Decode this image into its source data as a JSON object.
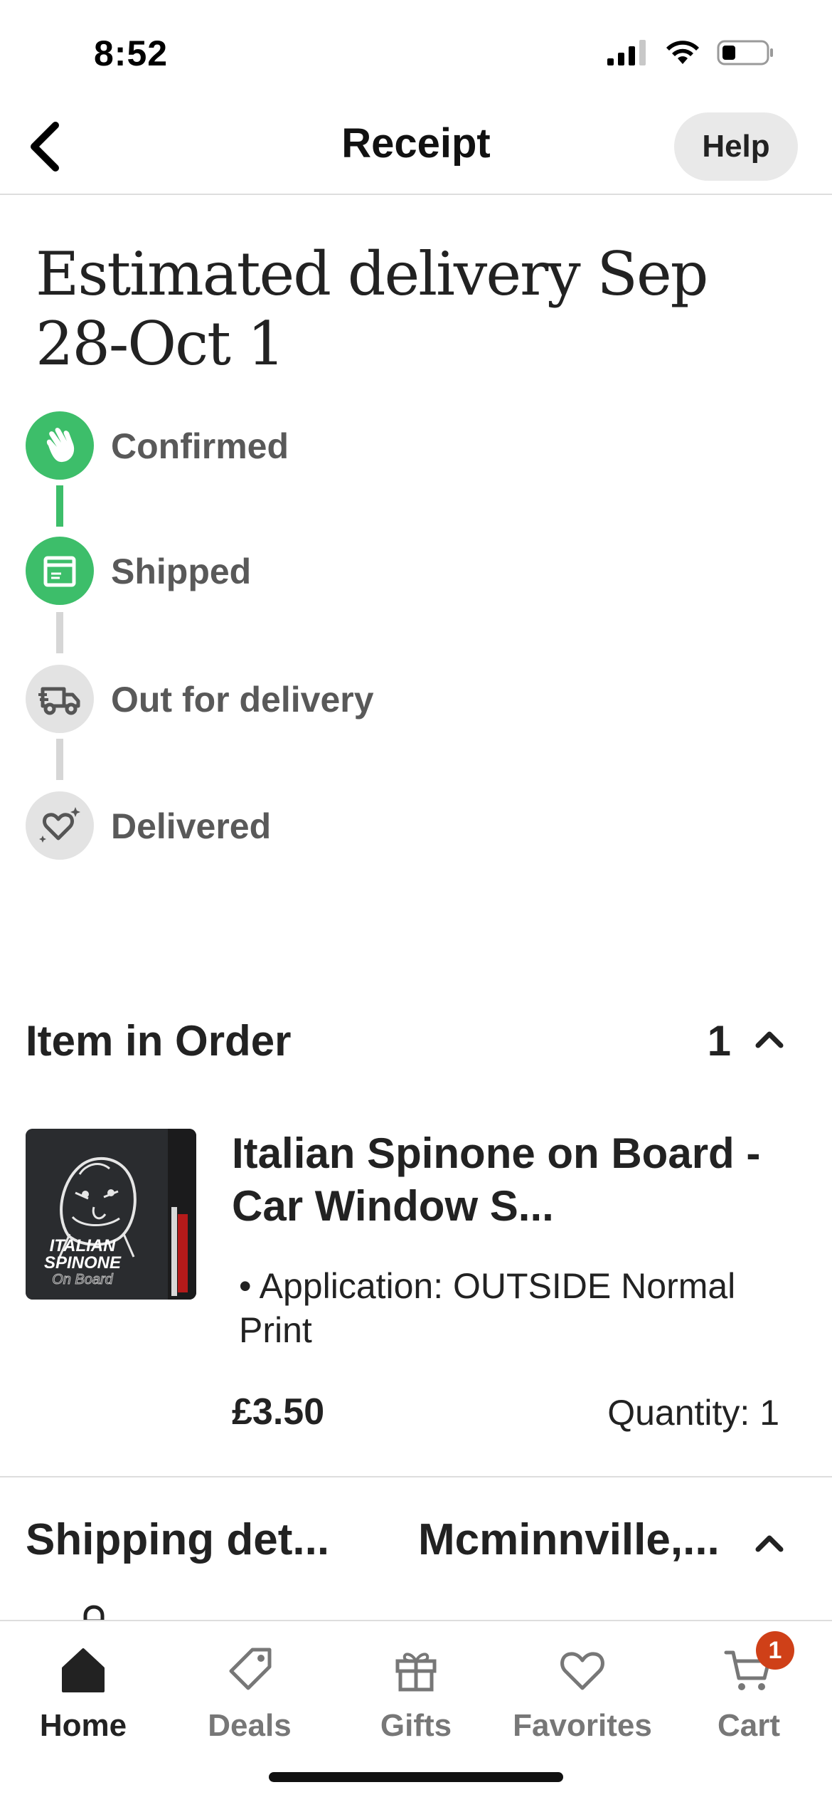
{
  "status_bar": {
    "time": "8:52"
  },
  "header": {
    "title": "Receipt",
    "help_label": "Help"
  },
  "delivery": {
    "title": "Estimated delivery Sep 28-Oct 1"
  },
  "tracker": {
    "steps": [
      {
        "label": "Confirmed",
        "state": "done",
        "icon": "waving-hand-icon"
      },
      {
        "label": "Shipped",
        "state": "done",
        "icon": "package-icon"
      },
      {
        "label": "Out for delivery",
        "state": "todo",
        "icon": "delivery-truck-icon"
      },
      {
        "label": "Delivered",
        "state": "todo",
        "icon": "heart-sparkle-icon"
      }
    ],
    "colors": {
      "done": "#3dbe6a",
      "todo": "#e3e3e3"
    }
  },
  "order": {
    "section_title": "Item in Order",
    "count": "1",
    "item": {
      "title": "Italian Spinone on Board  - Car Window S...",
      "variant": "• Application: OUTSIDE Normal Print",
      "price": "£3.50",
      "quantity": "Quantity: 1",
      "thumbnail_text_line1": "ITALIAN",
      "thumbnail_text_line2": "SPINONE",
      "thumbnail_text_line3": "On Board"
    }
  },
  "shipping": {
    "label": "Shipping det...",
    "city": "Mcminnville,..."
  },
  "bottom_nav": {
    "items": [
      {
        "label": "Home",
        "icon": "home-icon",
        "active": true
      },
      {
        "label": "Deals",
        "icon": "tag-icon",
        "active": false
      },
      {
        "label": "Gifts",
        "icon": "gift-icon",
        "active": false
      },
      {
        "label": "Favorites",
        "icon": "heart-icon",
        "active": false
      },
      {
        "label": "Cart",
        "icon": "cart-icon",
        "active": false
      }
    ],
    "cart_badge": "1"
  },
  "theme": {
    "accent_green": "#3dbe6a",
    "badge_orange": "#cf4018"
  }
}
